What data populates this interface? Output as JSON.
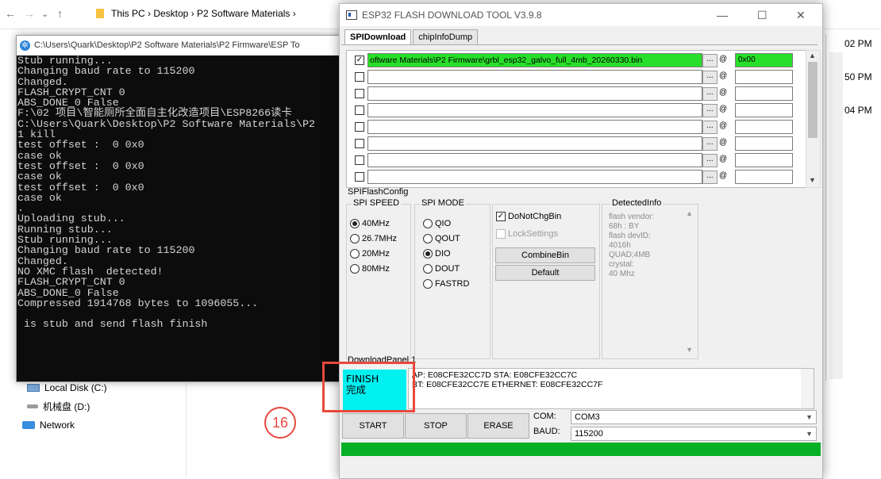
{
  "explorer": {
    "breadcrumb": "This PC  ›  Desktop  ›  P2 Software Materials  ›",
    "nav_items": [
      "Local Disk (C:)",
      "机械盘 (D:)",
      "Network"
    ],
    "times": [
      "02 PM",
      "50 PM",
      "04 PM"
    ]
  },
  "console": {
    "title": "C:\\Users\\Quark\\Desktop\\P2 Software Materials\\P2 Firmware\\ESP To",
    "lines": [
      "Stub running...",
      "Changing baud rate to 115200",
      "Changed.",
      "FLASH_CRYPT_CNT 0",
      "ABS_DONE_0 False",
      "F:\\02 项目\\智能厕所全面自主化改造项目\\ESP8266读卡",
      "C:\\Users\\Quark\\Desktop\\P2 Software Materials\\P2",
      "1 kill",
      "test offset :  0 0x0",
      "case ok",
      "test offset :  0 0x0",
      "case ok",
      "test offset :  0 0x0",
      "case ok",
      ".",
      "Uploading stub...",
      "Running stub...",
      "Stub running...",
      "Changing baud rate to 115200",
      "Changed.",
      "NO XMC flash  detected!",
      "FLASH_CRYPT_CNT 0",
      "ABS_DONE_0 False",
      "Compressed 1914768 bytes to 1096055...",
      "",
      " is stub and send flash finish"
    ]
  },
  "tool": {
    "title": "ESP32 FLASH DOWNLOAD TOOL V3.9.8",
    "tabs": [
      "SPIDownload",
      "chipInfoDump"
    ],
    "files": [
      {
        "checked": true,
        "path": "oftware Materials\\P2 Firmware\\grbl_esp32_galvo_full_4mb_20260330.bin",
        "addr": "0x00"
      },
      {
        "checked": false,
        "path": "",
        "addr": ""
      },
      {
        "checked": false,
        "path": "",
        "addr": ""
      },
      {
        "checked": false,
        "path": "",
        "addr": ""
      },
      {
        "checked": false,
        "path": "",
        "addr": ""
      },
      {
        "checked": false,
        "path": "",
        "addr": ""
      },
      {
        "checked": false,
        "path": "",
        "addr": ""
      },
      {
        "checked": false,
        "path": "",
        "addr": ""
      }
    ],
    "browse_label": "...",
    "at_label": "@",
    "spi_flash_config": "SPIFlashConfig",
    "spi_speed": {
      "title": "SPI SPEED",
      "options": [
        "40MHz",
        "26.7MHz",
        "20MHz",
        "80MHz"
      ],
      "selected": "40MHz"
    },
    "spi_mode": {
      "title": "SPI MODE",
      "options": [
        "QIO",
        "QOUT",
        "DIO",
        "DOUT",
        "FASTRD"
      ],
      "selected": "DIO"
    },
    "do_not_chg_bin": "DoNotChgBin",
    "lock_settings": "LockSettings",
    "combine_bin": "CombineBin",
    "default": "Default",
    "detected": {
      "title": "DetectedInfo",
      "text": "flash vendor:\n68h : BY\nflash devID:\n4016h\nQUAD;4MB\ncrystal:\n40 Mhz"
    },
    "download_panel": "DownloadPanel 1",
    "status_en": "FINISH",
    "status_cn": "完成",
    "mac_line1": "AP:  E08CFE32CC7D  STA:  E08CFE32CC7C",
    "mac_line2": "BT:  E08CFE32CC7E  ETHERNET:  E08CFE32CC7F",
    "start": "START",
    "stop": "STOP",
    "erase": "ERASE",
    "com_label": "COM:",
    "com_value": "COM3",
    "baud_label": "BAUD:",
    "baud_value": "115200",
    "progress": 1.0
  },
  "annotation": {
    "step": "16"
  },
  "colors": {
    "ok_green": "#28e02a",
    "status_cyan": "#00f0f0",
    "progress_green": "#06b025",
    "annotation_red": "#e8483d"
  }
}
